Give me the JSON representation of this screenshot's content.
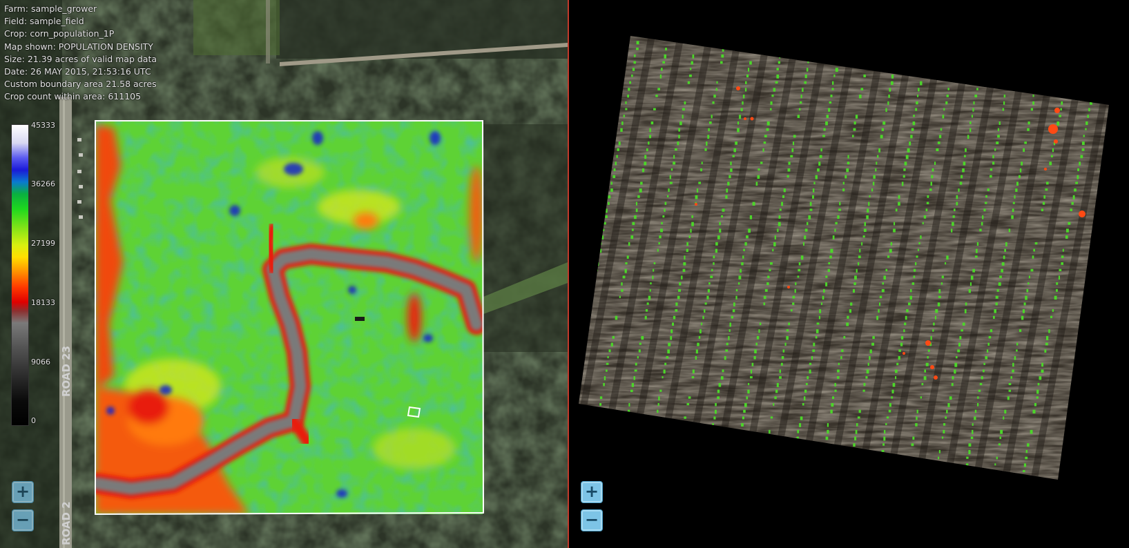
{
  "info": {
    "farm": "Farm: sample_grower",
    "field": "Field: sample_field",
    "crop": "Crop: corn_population_1P",
    "map_shown": "Map shown: POPULATION DENSITY",
    "size": "Size: 21.39 acres of valid map data",
    "date": "Date: 26 MAY 2015, 21:53:16 UTC",
    "boundary": "Custom boundary area 21.58 acres",
    "count": "Crop count within area: 611105"
  },
  "legend": {
    "labels": [
      "45333",
      "36266",
      "27199",
      "18133",
      "9066",
      "0"
    ],
    "colors": [
      "#ffffff",
      "#1a1ad8",
      "#1ed81e",
      "#ffe000",
      "#e00000",
      "#7a7a7a",
      "#000000"
    ]
  },
  "map": {
    "road_labels": [
      "ROAD 23",
      "ROAD 2"
    ]
  },
  "controls": {
    "zoom_in_glyph": "+",
    "zoom_out_glyph": "−"
  },
  "colors": {
    "divider": "#c0392b",
    "button": "#7dc4e6",
    "plant_marker": "#4cd62a",
    "gap_marker": "#ff4a14"
  }
}
